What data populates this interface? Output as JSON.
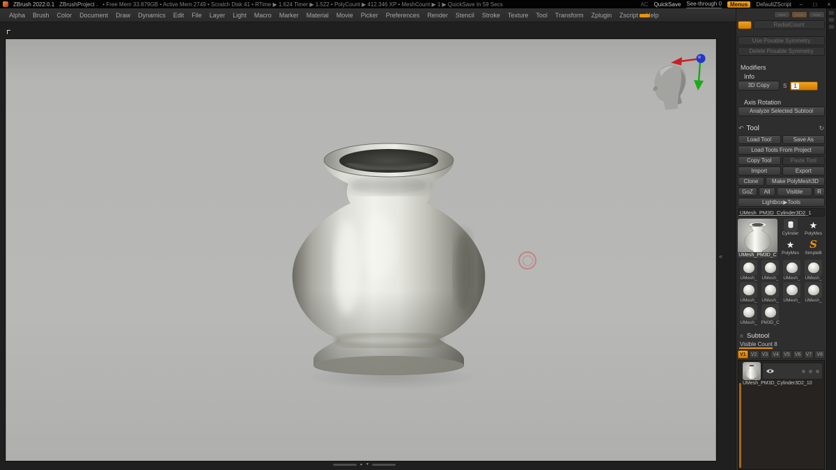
{
  "colors": {
    "accent": "#e8930c",
    "cursor_red": "#c65c5c",
    "axis_red": "#c52222",
    "axis_green": "#1da81d",
    "axis_blue": "#2336c8"
  },
  "icons": {
    "curl": "↶",
    "refresh": "↻",
    "star": "★",
    "s_brush": "S",
    "up": "▲",
    "down": "▼",
    "chevrons": "«"
  },
  "title_bar": {
    "app_name": "ZBrush 2022.0.1",
    "project_name": "ZBrushProject .",
    "stats": "• Free Mem 33.879GB  • Active Mem 2749  • Scratch Disk 41  • RTime ▶ 1.624  Timer ▶ 1.522  • PolyCount ▶ 412.346 XP  • MeshCount ▶ 1  ▶ QuickSave In 59 Secs",
    "ac": "AC",
    "quicksave": "QuickSave",
    "see_through": "See-through 0",
    "menus": "Menus",
    "script": "DefaultZScript",
    "minimize": "–",
    "maximize": "□",
    "close": "×"
  },
  "menu": {
    "items": [
      "Alpha",
      "Brush",
      "Color",
      "Document",
      "Draw",
      "Dynamics",
      "Edit",
      "File",
      "Layer",
      "Light",
      "Macro",
      "Marker",
      "Material",
      "Movie",
      "Picker",
      "Preferences",
      "Render",
      "Stencil",
      "Stroke",
      "Texture",
      "Tool",
      "Transform",
      "Zplugin",
      "Zscript",
      "Help"
    ]
  },
  "right_panel": {
    "top": {
      "radial_count": "RadialCount",
      "use_posable": "Use Posable Symmetry",
      "delete_posable": "Delete Posable Symmetry"
    },
    "modifiers": "Modifiers",
    "info": "Info",
    "copy3d": {
      "button": "3D Copy",
      "s": "S",
      "value": "1"
    },
    "axis_rotation": "Axis Rotation",
    "analyze": "Analyze Selected Subtool",
    "tool": {
      "header": "Tool",
      "load": "Load Tool",
      "save_as": "Save As",
      "load_from_project": "Load Tools From Project",
      "copy": "Copy Tool",
      "paste": "Paste Tool",
      "import": "Import",
      "export": "Export",
      "clone": "Clone",
      "make_polymesh": "Make PolyMesh3D",
      "goz": "GoZ",
      "all": "All",
      "visible": "Visible",
      "r": "R",
      "lightbox": "Lightbox▶Tools",
      "current_name": "UMesh_PM3D_Cylinder3D2_1",
      "active_label": "UMesh_PM3D_C",
      "quick": [
        {
          "label": "Cylinder"
        },
        {
          "label": "PolyMes"
        },
        {
          "label": "PolyMes"
        },
        {
          "label": "SimpleB"
        }
      ],
      "grid": [
        "UMesh_",
        "UMesh_",
        "UMesh_",
        "UMesh_",
        "UMesh_",
        "UMesh_",
        "UMesh_",
        "UMesh_",
        "UMesh_",
        "PM3D_C"
      ]
    },
    "subtool": {
      "header": "Subtool",
      "visible_count": "Visible Count 8",
      "tabs": [
        "V1",
        "V2",
        "V3",
        "V4",
        "V5",
        "V6",
        "V7",
        "V8"
      ],
      "item": "UMesh_PM3D_Cylinder3D2_10"
    }
  }
}
